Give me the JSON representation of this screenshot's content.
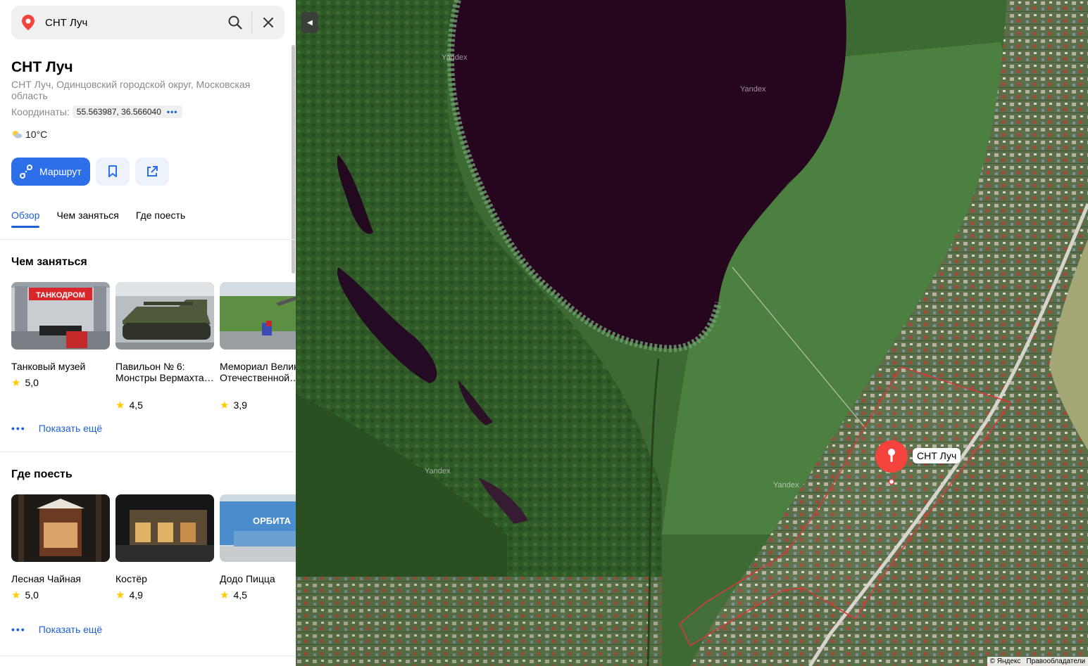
{
  "search": {
    "value": "СНТ Луч"
  },
  "place": {
    "title": "СНТ Луч",
    "address": "СНТ Луч, Одинцовский городской округ, Московская область",
    "coords_label": "Координаты:",
    "coords_value": "55.563987, 36.566040",
    "weather": "10°C"
  },
  "actions": {
    "route_label": "Маршрут"
  },
  "tabs": [
    {
      "label": "Обзор",
      "active": true
    },
    {
      "label": "Чем заняться",
      "active": false
    },
    {
      "label": "Где поесть",
      "active": false
    }
  ],
  "things_to_do": {
    "title": "Чем заняться",
    "items": [
      {
        "name": "Танковый музей",
        "rating": "5,0",
        "thumb_text": "ТАНКОДРОМ"
      },
      {
        "name": "Павильон № 6: Монстры Вермахта…",
        "rating": "4,5"
      },
      {
        "name": "Мемориал Великой Отечественной…",
        "rating": "3,9"
      }
    ],
    "more_label": "Показать ещё"
  },
  "where_to_eat": {
    "title": "Где поесть",
    "items": [
      {
        "name": "Лесная Чайная",
        "rating": "5,0"
      },
      {
        "name": "Костёр",
        "rating": "4,9"
      },
      {
        "name": "Додо Пицца",
        "rating": "4,5",
        "thumb_text": "ОРБИТА"
      }
    ],
    "more_label": "Показать ещё"
  },
  "map": {
    "pin_label": "СНТ Луч",
    "watermark": "Yandex",
    "copyright": "© Яндекс",
    "copyright_link": "Правообладатели",
    "collapse_icon": "triangle-left"
  },
  "colors": {
    "accent": "#2d6fe9",
    "pin": "#f4433c",
    "boundary": "#d33a3a",
    "star": "#ffcc00"
  }
}
